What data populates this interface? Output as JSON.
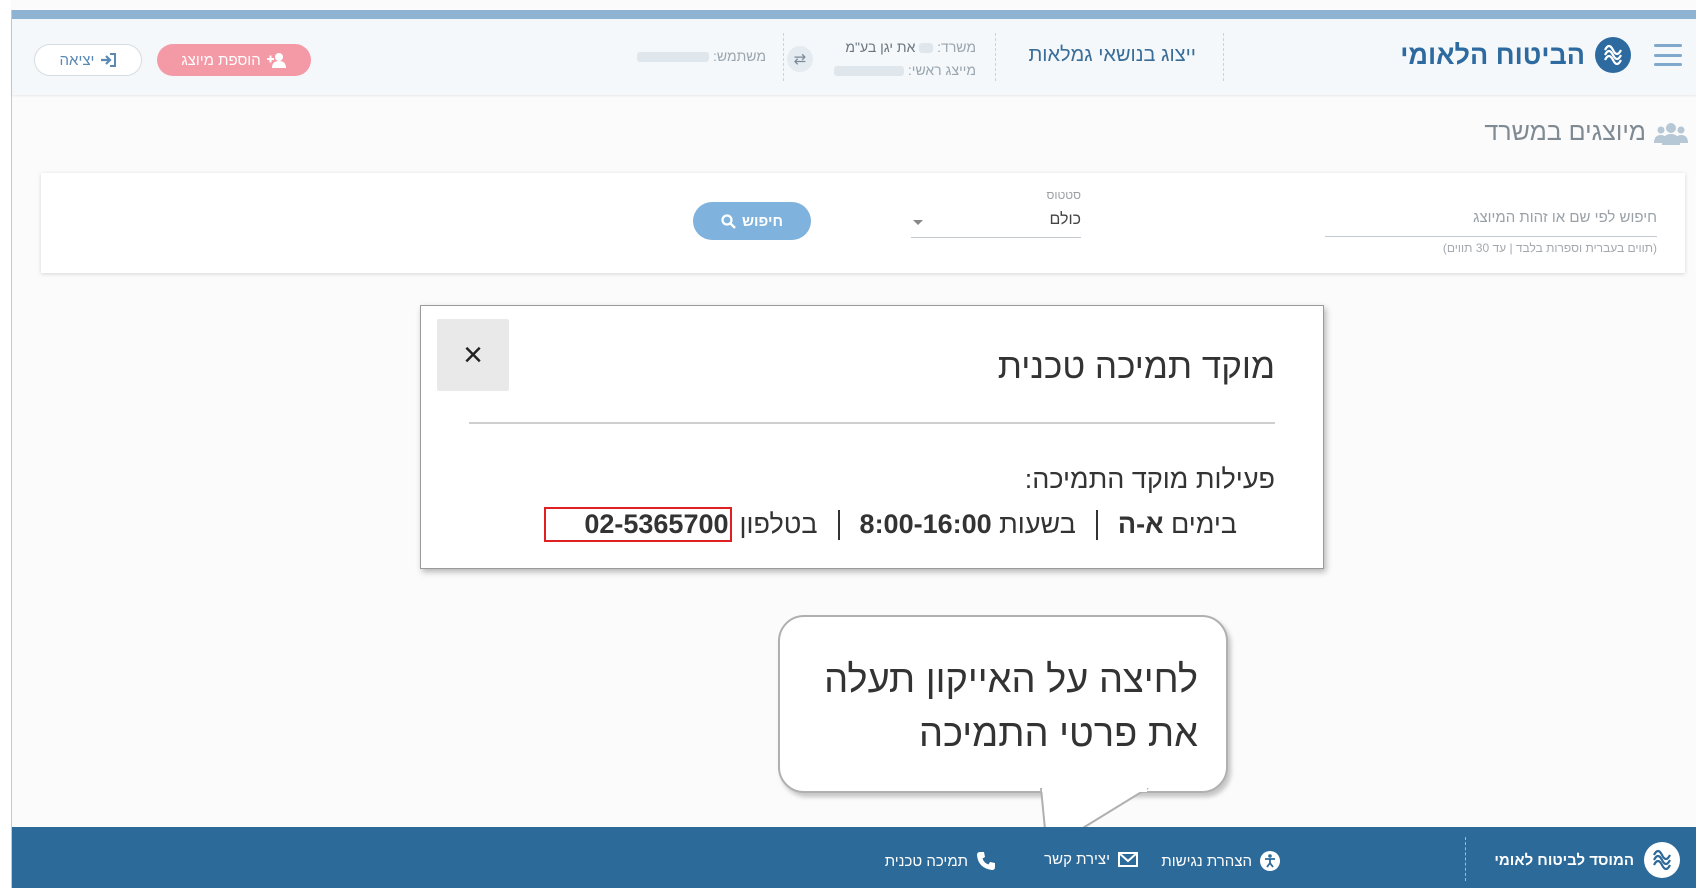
{
  "header": {
    "logo_text": "הביטוח הלאומי",
    "app_title": "ייצוג בנושאי גמלאות",
    "office_label": "משרד:",
    "office_name": "את יגן בע\"מ",
    "chief_label": "מייצג ראשי:",
    "user_label": "משתמש:",
    "add_button_label": "הוספת מיוצג",
    "exit_button_label": "יציאה"
  },
  "page": {
    "title": "מיוצגים במשרד"
  },
  "search": {
    "input_placeholder": "חיפוש לפי שם או זהות המיוצג",
    "input_hint": "(תווים בעברית וספרות בלבד | עד 30 תווים)",
    "status_label": "סטטוס",
    "status_value": "כולם",
    "search_button_label": "חיפוש"
  },
  "modal": {
    "title": "מוקד תמיכה טכנית",
    "subtitle": "פעילות מוקד התמיכה:",
    "days_prefix": "בימים",
    "days_value": "א-ה",
    "hours_prefix": "בשעות",
    "hours_value": "8:00-16:00",
    "phone_prefix": "בטלפון",
    "phone_value": "02-5365700",
    "close_label": "×"
  },
  "callout": {
    "line1": "לחיצה על האייקון תעלה",
    "line2": "את פרטי התמיכה"
  },
  "footer": {
    "logo_text": "המוסד לביטוח לאומי",
    "accessibility_label": "הצהרת נגישות",
    "contact_label": "יצירת קשר",
    "support_label": "תמיכה טכנית"
  },
  "colors": {
    "brand": "#2d6a9f",
    "footer_bg": "#2c6a9a",
    "add_button": "#f49aa6",
    "search_button": "#7fb2dc",
    "highlight": "#e02020"
  }
}
